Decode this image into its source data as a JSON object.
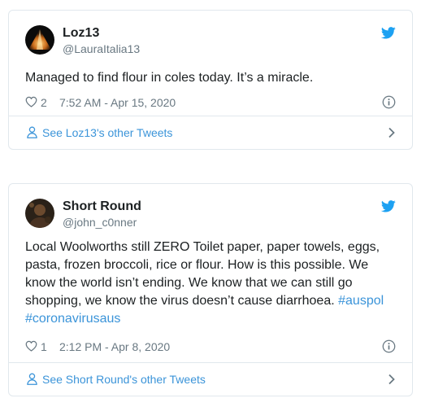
{
  "tweets": [
    {
      "display_name": "Loz13",
      "handle": "@LauraItalia13",
      "text": "Managed to find flour in coles today. It’s a miracle.",
      "likes": "2",
      "time": "7:52 AM - Apr 15, 2020",
      "footer_link": "See Loz13's other Tweets",
      "avatar_icon": "pyramid-light-avatar"
    },
    {
      "display_name": "Short Round",
      "handle": "@john_c0nner",
      "text": "Local Woolworths still ZERO Toilet paper, paper towels, eggs, pasta, frozen broccoli, rice or flour. How is this possible. We know the world isn’t ending. We know that we can still go shopping, we know the virus doesn’t cause diarrhoea.",
      "hashtags": [
        "#auspol",
        "#coronavirusaus"
      ],
      "likes": "1",
      "time": "2:12 PM - Apr 8, 2020",
      "footer_link": "See Short Round's other Tweets",
      "avatar_icon": "dark-portrait-avatar"
    }
  ],
  "separator": "·",
  "colors": {
    "text": "#1c2022",
    "muted": "#697882",
    "link": "#3b94d9",
    "twitter_blue": "#1da1f2",
    "border": "#e1e8ed"
  }
}
